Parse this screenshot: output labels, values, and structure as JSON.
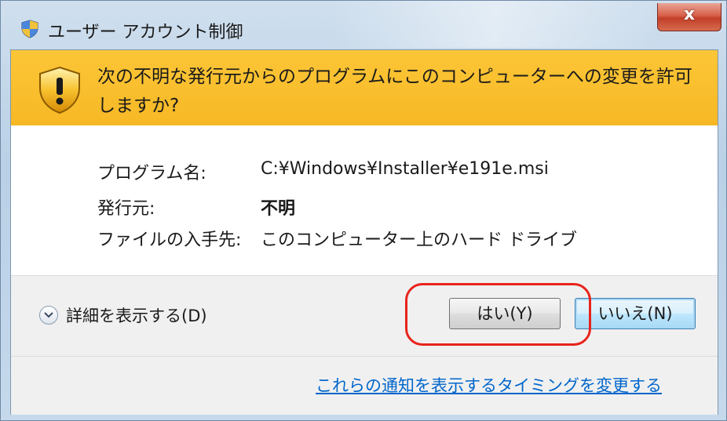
{
  "window": {
    "title": "ユーザー アカウント制御",
    "close_label": "x"
  },
  "banner": {
    "message": "次の不明な発行元からのプログラムにこのコンピューターへの変更を許可しますか?"
  },
  "details": {
    "rows": [
      {
        "label": "プログラム名:",
        "value": "C:¥Windows¥Installer¥e191e.msi"
      },
      {
        "label": "発行元:",
        "value": "不明"
      },
      {
        "label": "ファイルの入手先:",
        "value": "このコンピューター上のハード ドライブ"
      }
    ]
  },
  "footer": {
    "show_details_label": "詳細を表示する(D)",
    "yes_label": "はい(Y)",
    "no_label": "いいえ(N)",
    "change_notification_link": "これらの通知を表示するタイミングを変更する"
  },
  "colors": {
    "banner_bg": "#f7b825",
    "link": "#0066cc",
    "annotation_ring": "#e8231b",
    "close_button": "#c23f28"
  },
  "icons": {
    "title": "uac-shield-icon",
    "warning": "warning-shield-icon",
    "expand": "chevron-down-icon"
  }
}
